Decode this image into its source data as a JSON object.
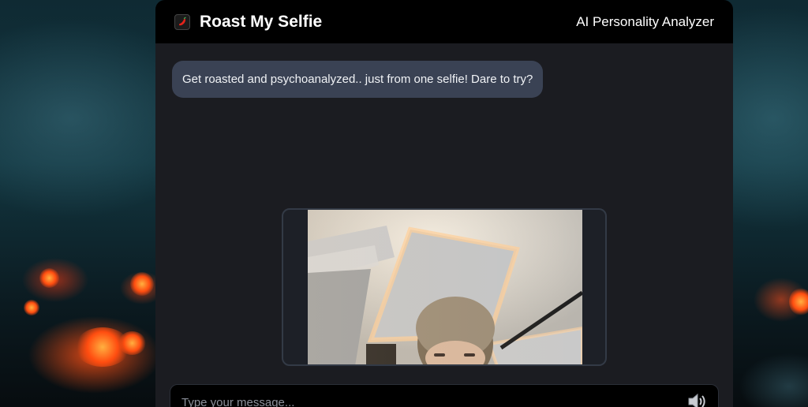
{
  "header": {
    "title": "Roast My Selfie",
    "logo_icon": "chili-pepper-icon",
    "subtitle": "AI Personality Analyzer"
  },
  "chat": {
    "messages": [
      {
        "role": "bot",
        "text": "Get roasted and psychoanalyzed.. just from one selfie! Dare to try?"
      }
    ]
  },
  "camera_preview": {
    "subject": "selfie photo of a person under a lit ceiling"
  },
  "composer": {
    "placeholder": "Type your message...",
    "mic_icon": "microphone-icon"
  },
  "colors": {
    "panel_bg": "#1b1c21",
    "header_bg": "#000000",
    "bubble_bg": "#3a4254",
    "accent_red": "#e2231a"
  }
}
